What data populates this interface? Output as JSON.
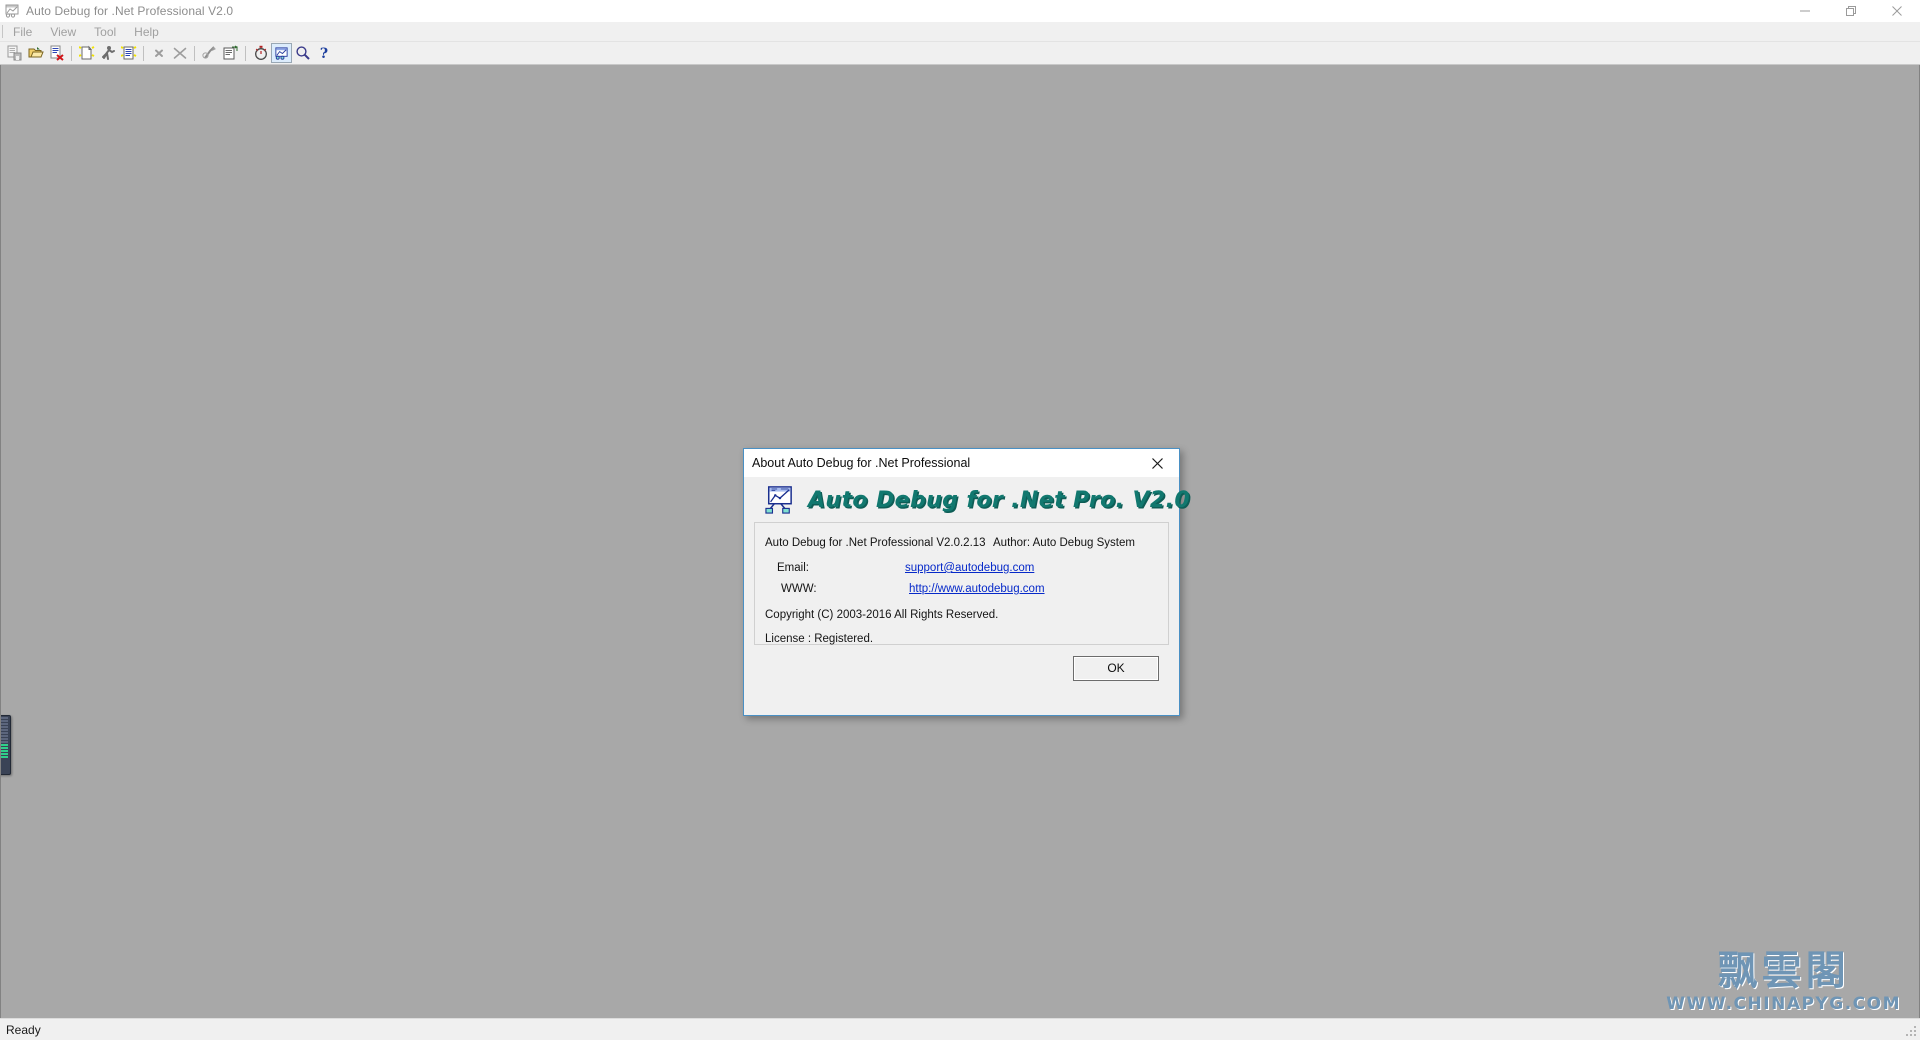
{
  "window": {
    "title": "Auto Debug for .Net Professional V2.0",
    "icon": "app-chart-icon",
    "controls": {
      "minimize": "minimize-icon",
      "restore": "restore-icon",
      "close": "close-icon"
    }
  },
  "menubar": {
    "items": [
      {
        "label": "File"
      },
      {
        "label": "View"
      },
      {
        "label": "Tool"
      },
      {
        "label": "Help"
      }
    ]
  },
  "toolbar": {
    "buttons": [
      {
        "name": "save-project-icon",
        "enabled": false
      },
      {
        "name": "open-folder-icon",
        "enabled": true
      },
      {
        "name": "close-document-icon",
        "enabled": true
      },
      {
        "sep": true
      },
      {
        "name": "new-document-icon",
        "enabled": true
      },
      {
        "name": "run-debug-icon",
        "enabled": true
      },
      {
        "name": "new-report-icon",
        "enabled": true
      },
      {
        "sep": true
      },
      {
        "name": "remove-item-icon",
        "enabled": false
      },
      {
        "name": "remove-all-icon",
        "enabled": false
      },
      {
        "sep": true
      },
      {
        "name": "disassemble-icon",
        "enabled": false
      },
      {
        "name": "properties-icon",
        "enabled": true
      },
      {
        "sep": true
      },
      {
        "name": "stopwatch-icon",
        "enabled": true
      },
      {
        "name": "about-icon",
        "enabled": true,
        "pressed": true
      },
      {
        "name": "search-icon",
        "enabled": true
      },
      {
        "name": "help-icon",
        "enabled": true
      }
    ]
  },
  "statusbar": {
    "text": "Ready"
  },
  "watermark": {
    "chinese": "飘雲閣",
    "site": "WWW.CHINAPYG.COM",
    "color": "#6f95b5"
  },
  "dialog": {
    "title": "About Auto Debug for .Net Professional",
    "close_icon": "close-icon",
    "logo_icon": "app-chart-icon",
    "brand": "Auto Debug for .Net Pro. V2.0",
    "brand_color": "#11786f",
    "info": {
      "product": "Auto Debug for .Net Professional V2.0.2.13",
      "author": "Author: Auto Debug System",
      "email_label": "Email:",
      "email_value": "support@autodebug.com",
      "www_label": "WWW:",
      "www_value": "http://www.autodebug.com",
      "copyright": "Copyright (C) 2003-2016 All Rights Reserved.",
      "license": "License : Registered.",
      "link_color": "#0629c9"
    },
    "ok_label": "OK"
  }
}
